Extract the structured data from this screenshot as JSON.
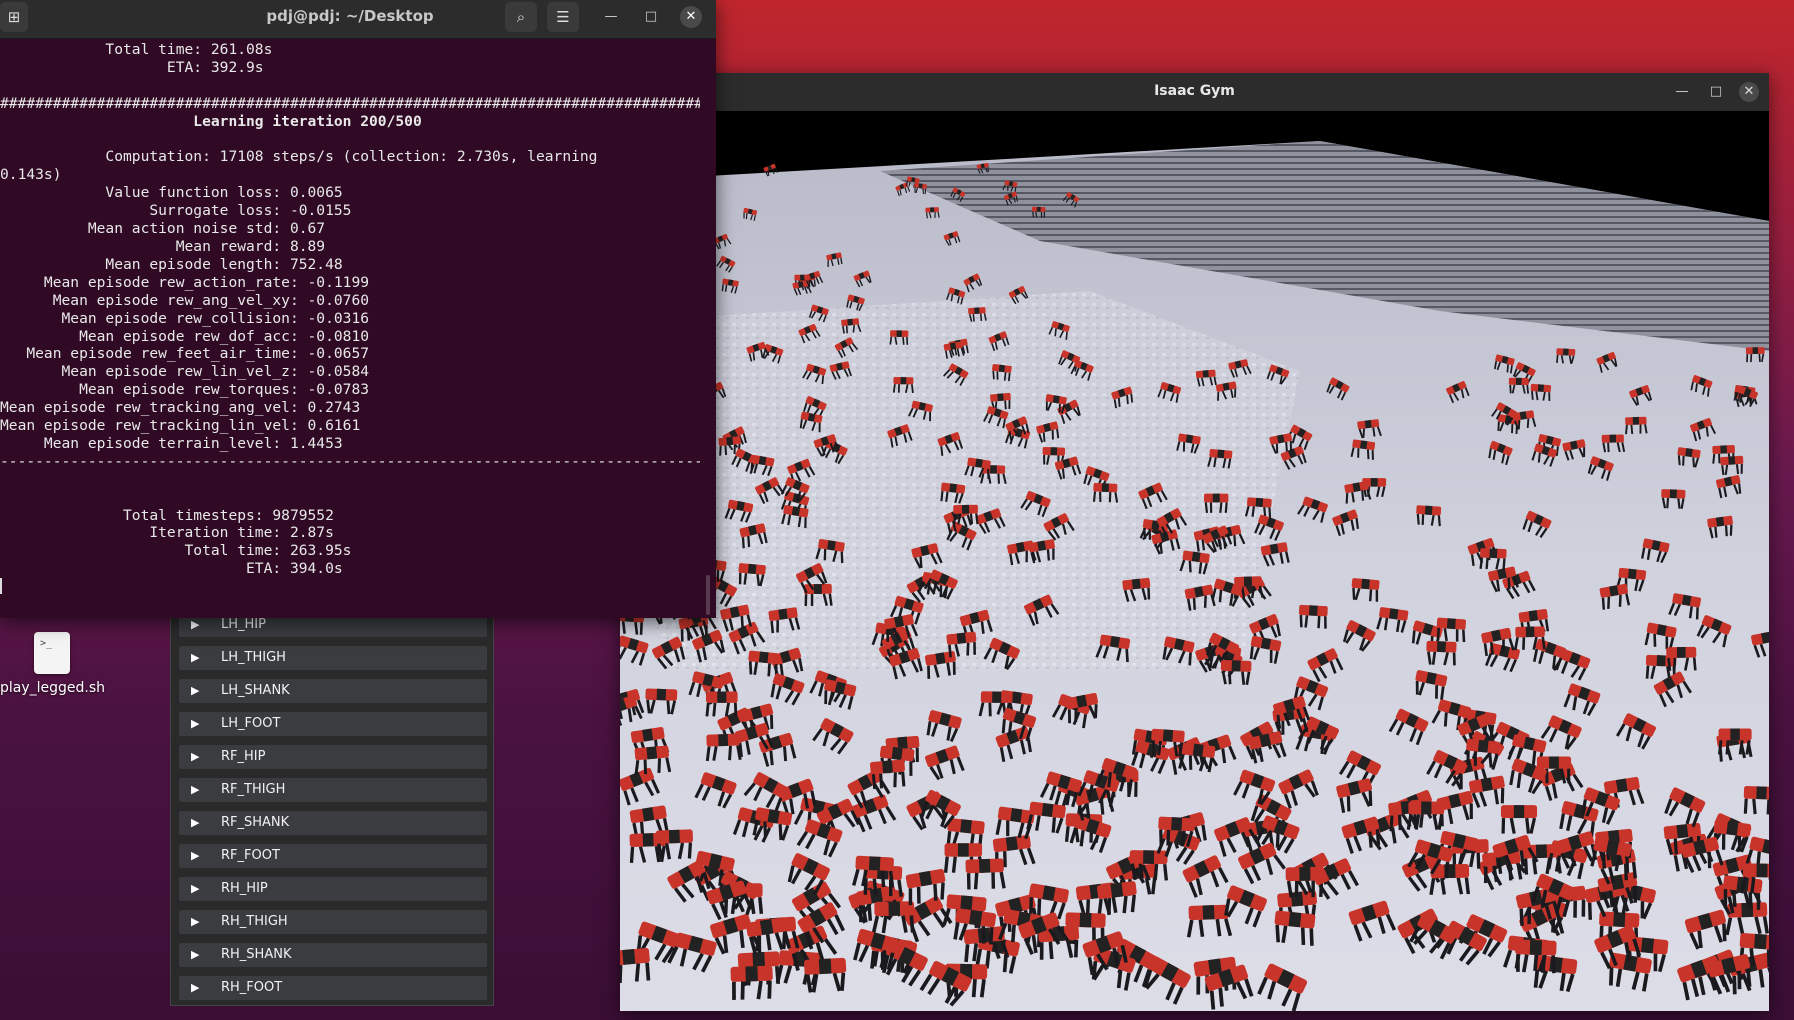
{
  "desktop": {
    "icon_label": "play_legged.sh",
    "icon_glyph": ">_"
  },
  "terminal": {
    "title": "pdj@pdj: ~/Desktop",
    "lines": [
      "            Total time: 261.08s",
      "                   ETA: 392.9s",
      "",
      "################################################################################",
      "",
      "",
      "            Computation: 17108 steps/s (collection: 2.730s, learning",
      "0.143s)",
      "            Value function loss: 0.0065",
      "                 Surrogate loss: -0.0155",
      "          Mean action noise std: 0.67",
      "                    Mean reward: 8.89",
      "            Mean episode length: 752.48",
      "     Mean episode rew_action_rate: -0.1199",
      "      Mean episode rew_ang_vel_xy: -0.0760",
      "       Mean episode rew_collision: -0.0316",
      "         Mean episode rew_dof_acc: -0.0810",
      "   Mean episode rew_feet_air_time: -0.0657",
      "       Mean episode rew_lin_vel_z: -0.0584",
      "         Mean episode rew_torques: -0.0783",
      "Mean episode rew_tracking_ang_vel: 0.2743",
      "Mean episode rew_tracking_lin_vel: 0.6161",
      "     Mean episode terrain_level: 1.4453",
      "--------------------------------------------------------------------------------",
      "",
      "",
      "              Total timesteps: 9879552",
      "                 Iteration time: 2.87s",
      "                     Total time: 263.95s",
      "                            ETA: 394.0s",
      ""
    ],
    "heading": "Learning iteration 200/500"
  },
  "gym": {
    "title": "Isaac Gym"
  },
  "joints": [
    "LH_HIP",
    "LH_THIGH",
    "LH_SHANK",
    "LH_FOOT",
    "RF_HIP",
    "RF_THIGH",
    "RF_SHANK",
    "RF_FOOT",
    "RH_HIP",
    "RH_THIGH",
    "RH_SHANK",
    "RH_FOOT"
  ],
  "colors": {
    "robot": "#c9342a",
    "ground": "#c8cad8",
    "terminal_bg": "#300a24"
  }
}
